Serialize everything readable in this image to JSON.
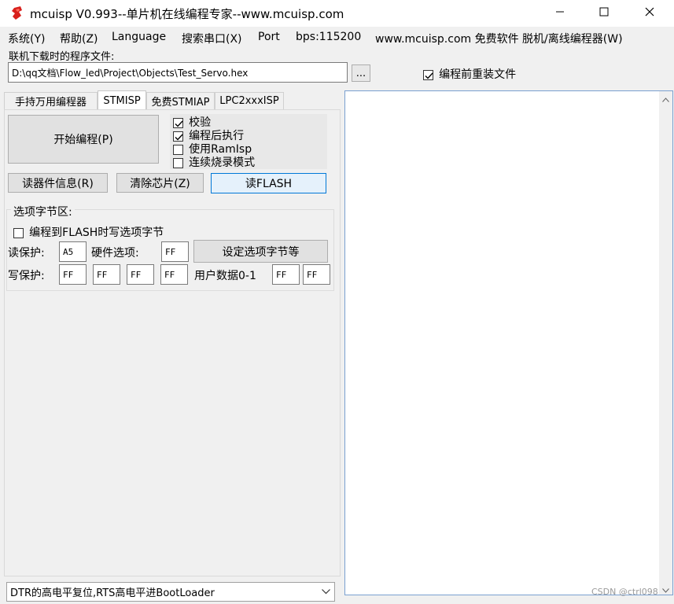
{
  "window": {
    "title": "mcuisp V0.993--单片机在线编程专家--www.mcuisp.com"
  },
  "menu": {
    "items": [
      "系统(Y)",
      "帮助(Z)",
      "Language",
      "搜索串口(X)",
      "Port",
      "bps:115200",
      "www.mcuisp.com 免费软件 脱机/离线编程器(W)"
    ]
  },
  "file": {
    "label": "联机下载时的程序文件:",
    "path": "D:\\qq文档\\Flow_led\\Project\\Objects\\Test_Servo.hex",
    "browse_label": "...",
    "reload_label": "编程前重装文件",
    "reload_checked": true
  },
  "tabs": [
    "手持万用编程器",
    "STMISP",
    "免费STMIAP",
    "LPC2xxxISP"
  ],
  "stmisp": {
    "start_button": "开始编程(P)",
    "options": [
      {
        "label": "校验",
        "checked": true
      },
      {
        "label": "编程后执行",
        "checked": true
      },
      {
        "label": "使用RamIsp",
        "checked": false
      },
      {
        "label": "连续烧录模式",
        "checked": false
      }
    ],
    "read_info_button": "读器件信息(R)",
    "erase_button": "清除芯片(Z)",
    "read_flash_button": "读FLASH",
    "option_bytes": {
      "group_label": "选项字节区:",
      "write_on_program_label": "编程到FLASH时写选项字节",
      "write_on_program_checked": false,
      "read_protect_label": "读保护:",
      "read_protect_value": "A5",
      "hw_option_label": "硬件选项:",
      "hw_option_value": "FF",
      "set_button": "设定选项字节等",
      "write_protect_label": "写保护:",
      "write_protect_values": [
        "FF",
        "FF",
        "FF",
        "FF"
      ],
      "user_data_label": "用户数据0-1",
      "user_data_values": [
        "FF",
        "FF"
      ]
    }
  },
  "bootloader_select": {
    "selected": "DTR的高电平复位,RTS高电平进BootLoader"
  },
  "watermark": "CSDN @ctrl098"
}
